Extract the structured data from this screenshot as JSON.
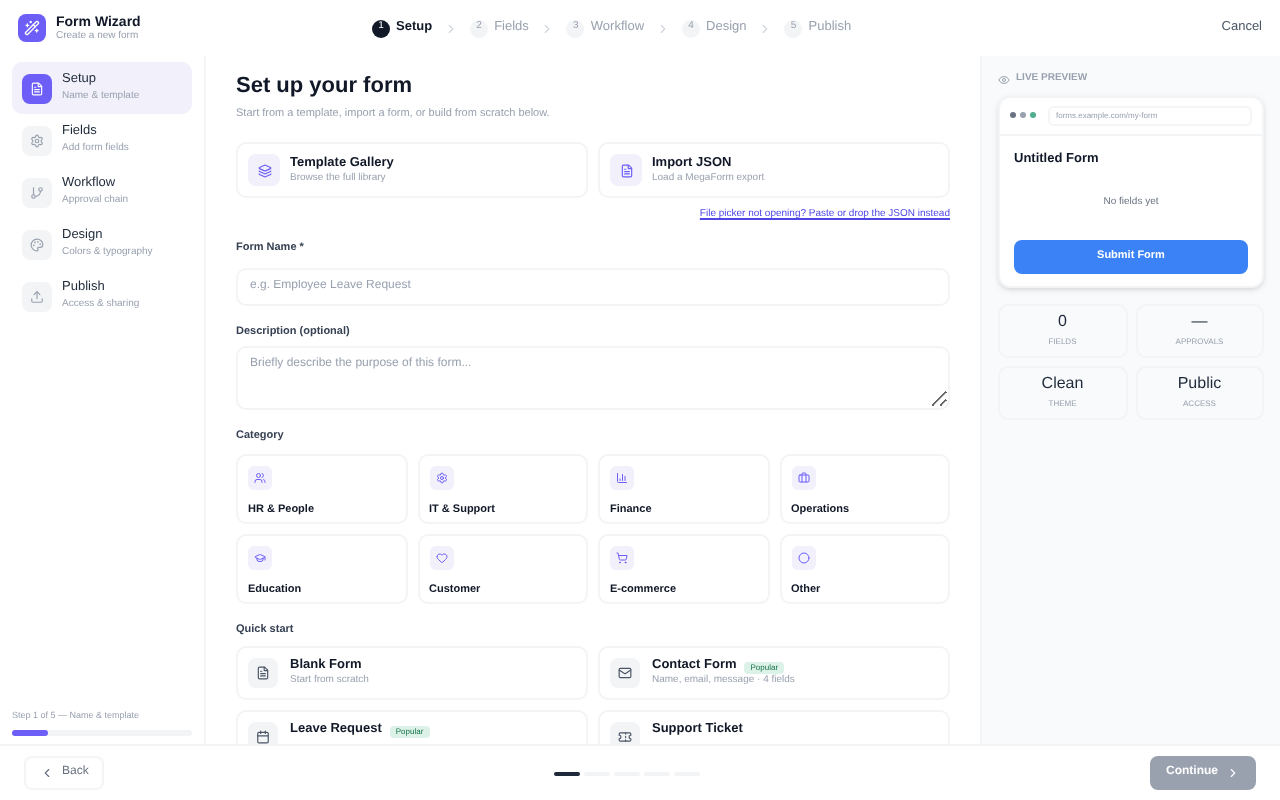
{
  "app": {
    "title": "Form Wizard",
    "subtitle": "Create a new form"
  },
  "steps": [
    {
      "number": "1",
      "label": "Setup",
      "selected": true
    },
    {
      "number": "2",
      "label": "Fields",
      "selected": false
    },
    {
      "number": "3",
      "label": "Workflow",
      "selected": false
    },
    {
      "number": "4",
      "label": "Design",
      "selected": false
    },
    {
      "number": "5",
      "label": "Publish",
      "selected": false
    }
  ],
  "cancel": "Cancel",
  "sidebar": {
    "items": [
      {
        "kind": "file",
        "label": "Setup",
        "caption": "Name & template",
        "selected": true
      },
      {
        "kind": "gear",
        "label": "Fields",
        "caption": "Add form fields",
        "selected": false
      },
      {
        "kind": "branch",
        "label": "Workflow",
        "caption": "Approval chain",
        "selected": false
      },
      {
        "kind": "palette",
        "label": "Design",
        "caption": "Colors & typography",
        "selected": false
      },
      {
        "kind": "upload",
        "label": "Publish",
        "caption": "Access & sharing",
        "selected": false
      }
    ],
    "progress": {
      "text": "Step 1 of 5 — Name & template",
      "level": 0.2
    }
  },
  "main": {
    "title": "Set up your form",
    "subtitle": "Start from a template, import a form, or build from scratch below.",
    "sources": [
      {
        "kind": "layers",
        "title": "Template Gallery",
        "caption": "Browse the full library"
      },
      {
        "kind": "file",
        "title": "Import JSON",
        "caption": "Load a MegaForm export"
      }
    ],
    "link": "File picker not opening? Paste or drop the JSON instead",
    "form_name": {
      "label": "Form Name *",
      "placeholder": "e.g. Employee Leave Request"
    },
    "description": {
      "label": "Description (optional)",
      "placeholder": "Briefly describe the purpose of this form..."
    },
    "category": {
      "label": "Category",
      "items": [
        {
          "kind": "users",
          "label": "HR & People"
        },
        {
          "kind": "gear",
          "label": "IT & Support"
        },
        {
          "kind": "chart",
          "label": "Finance"
        },
        {
          "kind": "briefcase",
          "label": "Operations"
        },
        {
          "kind": "cap",
          "label": "Education"
        },
        {
          "kind": "heart",
          "label": "Customer"
        },
        {
          "kind": "cart",
          "label": "E-commerce"
        },
        {
          "kind": "dots",
          "label": "Other"
        }
      ]
    },
    "quick_start": {
      "label": "Quick start",
      "items": [
        {
          "kind": "file",
          "title": "Blank Form",
          "caption": "Start from scratch"
        },
        {
          "kind": "mail",
          "title": "Contact Form",
          "badge": "Popular",
          "caption": "Name, email, message · 4 fields"
        },
        {
          "kind": "calendar",
          "title": "Leave Request",
          "badge": "Popular"
        },
        {
          "kind": "ticket",
          "title": "Support Ticket"
        }
      ]
    }
  },
  "preview": {
    "label": "LIVE PREVIEW",
    "url": "forms.example.com/my-form",
    "form_title": "Untitled Form",
    "empty": "No fields yet",
    "submit": "Submit Form",
    "stats": [
      {
        "value": "0",
        "label": "FIELDS"
      },
      {
        "value": "—",
        "label": "APPROVALS"
      },
      {
        "value": "Clean",
        "label": "THEME"
      },
      {
        "value": "Public",
        "label": "ACCESS"
      }
    ]
  },
  "footer": {
    "back": "Back",
    "pages": [
      {
        "selected": true
      },
      {
        "selected": false
      },
      {
        "selected": false
      },
      {
        "selected": false
      },
      {
        "selected": false
      }
    ],
    "continue": {
      "label": "Continue",
      "disabled": true
    }
  }
}
